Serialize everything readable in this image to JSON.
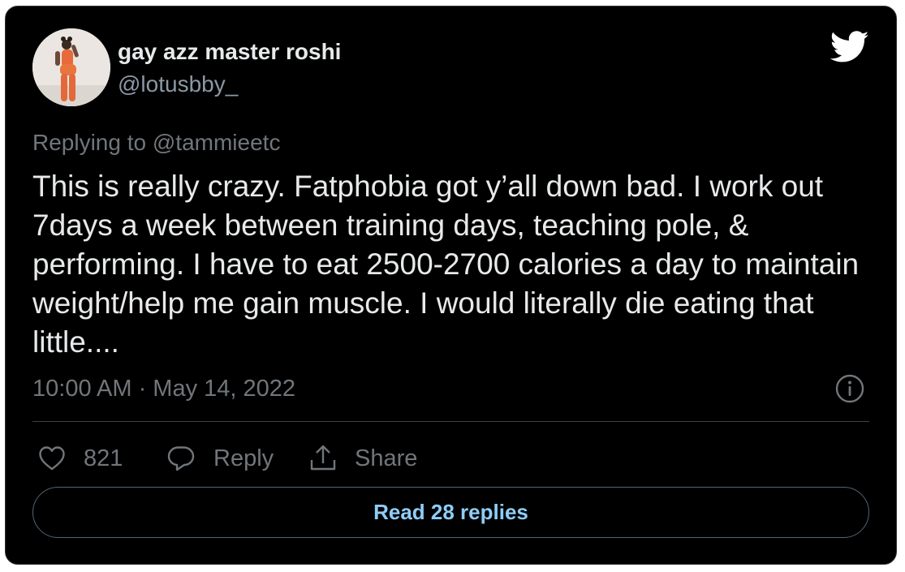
{
  "author": {
    "display_name": "gay azz master roshi",
    "handle": "@lotusbby_",
    "avatar_icon": "profile-photo"
  },
  "brand": {
    "icon": "twitter-bird-icon",
    "color": "#ffffff"
  },
  "reply_context": {
    "prefix": "Replying to ",
    "mention": "@tammieetc"
  },
  "tweet": {
    "text": "This is really crazy. Fatphobia got y’all down bad. I work out 7days a week between training days, teaching pole, & performing. I have to eat 2500-2700 calories a day to maintain weight/help me gain muscle. I would literally die eating that little....",
    "timestamp": "10:00 AM · May 14, 2022"
  },
  "actions": {
    "like_count": "821",
    "reply_label": "Reply",
    "share_label": "Share"
  },
  "footer": {
    "read_replies_label": "Read 28 replies",
    "accent_color": "#8ecdf8"
  },
  "colors": {
    "background": "#000000",
    "primary_text": "#e7e9ea",
    "secondary_text": "#71767b"
  }
}
